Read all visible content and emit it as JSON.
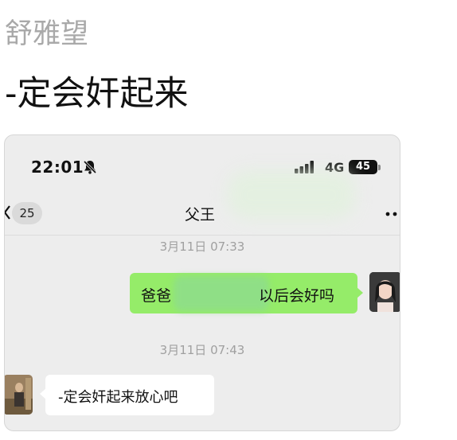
{
  "post": {
    "author": "舒雅望",
    "title": "-定会奸起来"
  },
  "status_bar": {
    "time": "22:01",
    "network": "4G",
    "battery": "45",
    "icons": [
      "bell-slash-icon",
      "signal-icon",
      "battery-icon"
    ]
  },
  "chat_header": {
    "unread_badge": "25",
    "title": "父王",
    "icons": [
      "back-chevron-icon",
      "more-options-icon"
    ]
  },
  "messages": [
    {
      "timestamp": "3月11日 07:33",
      "direction": "outgoing",
      "text_before": "爸爸",
      "text_after": "以后会好吗",
      "partially_obscured": true
    },
    {
      "timestamp": "3月11日 07:43",
      "direction": "incoming",
      "text": "-定会奸起来放心吧"
    }
  ],
  "colors": {
    "chat_background": "#ededed",
    "outgoing_bubble": "#95ec69",
    "incoming_bubble": "#ffffff",
    "timestamp_text": "#a0a0a0",
    "author_text": "#a9a9a9"
  }
}
